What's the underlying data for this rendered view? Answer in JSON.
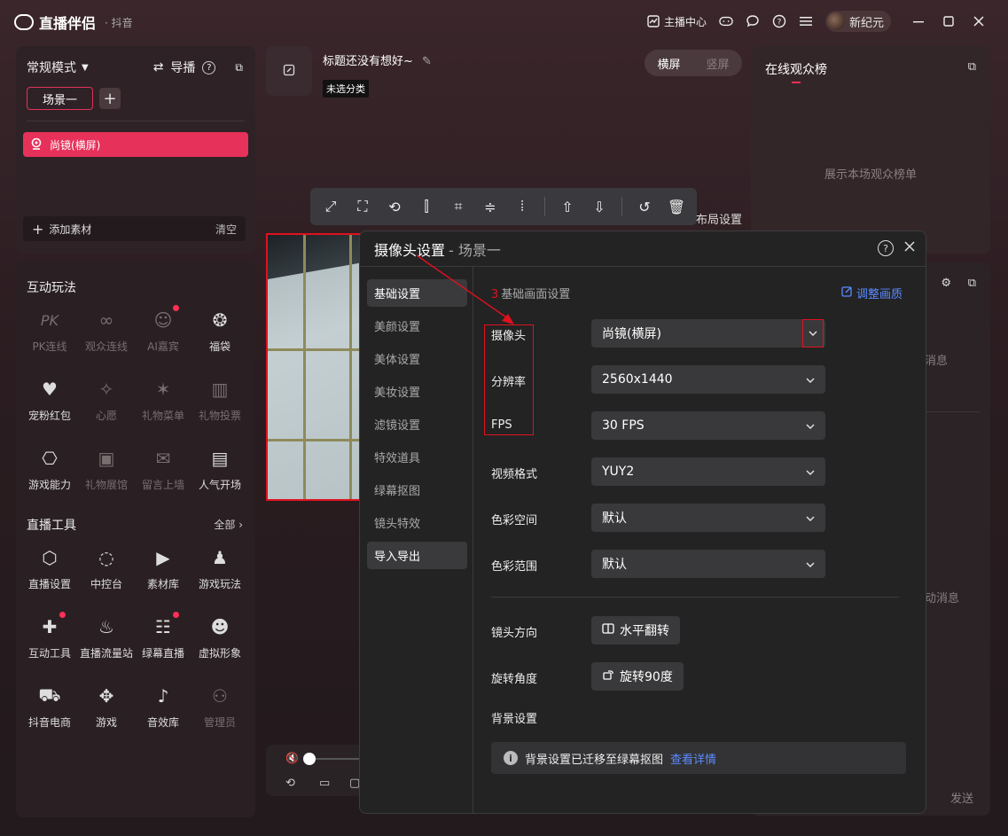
{
  "app": {
    "name": "直播伴侣",
    "platform": "· 抖音"
  },
  "titlebar": {
    "host_center": "主播中心",
    "username": "新纪元"
  },
  "scene_panel": {
    "mode": "常规模式",
    "guide": "导播",
    "scene_tab": "场景一",
    "source": "尚镜(横屏)",
    "add_source": "添加素材",
    "clear": "清空"
  },
  "interactive": {
    "title": "互动玩法",
    "items": [
      {
        "label": "PK连线",
        "icon": "pk-icon",
        "dim": true
      },
      {
        "label": "观众连线",
        "icon": "audience-link-icon",
        "dim": true
      },
      {
        "label": "AI嘉宾",
        "icon": "ai-guest-icon",
        "dim": true,
        "dot": true
      },
      {
        "label": "福袋",
        "icon": "lucky-bag-icon",
        "dim": false
      },
      {
        "label": "宠粉红包",
        "icon": "red-packet-icon",
        "dim": false
      },
      {
        "label": "心愿",
        "icon": "wish-icon",
        "dim": true
      },
      {
        "label": "礼物菜单",
        "icon": "gift-menu-icon",
        "dim": true
      },
      {
        "label": "礼物投票",
        "icon": "gift-vote-icon",
        "dim": true
      },
      {
        "label": "游戏能力",
        "icon": "game-ability-icon",
        "dim": false
      },
      {
        "label": "礼物展馆",
        "icon": "gift-hall-icon",
        "dim": true
      },
      {
        "label": "留言上墙",
        "icon": "message-wall-icon",
        "dim": true
      },
      {
        "label": "人气开场",
        "icon": "popularity-icon",
        "dim": false
      }
    ]
  },
  "live_tools": {
    "title": "直播工具",
    "all": "全部",
    "items": [
      {
        "label": "直播设置",
        "icon": "live-settings-icon",
        "dim": false
      },
      {
        "label": "中控台",
        "icon": "control-panel-icon",
        "dim": false
      },
      {
        "label": "素材库",
        "icon": "material-lib-icon",
        "dim": false
      },
      {
        "label": "游戏玩法",
        "icon": "game-play-icon",
        "dim": false
      },
      {
        "label": "互动工具",
        "icon": "interactive-tool-icon",
        "dim": false,
        "dot": true
      },
      {
        "label": "直播流量站",
        "icon": "traffic-station-icon",
        "dim": false
      },
      {
        "label": "绿幕直播",
        "icon": "green-screen-icon",
        "dim": false,
        "dot": true
      },
      {
        "label": "虚拟形象",
        "icon": "avatar-virtual-icon",
        "dim": false
      },
      {
        "label": "抖音电商",
        "icon": "ecommerce-icon",
        "dim": false
      },
      {
        "label": "游戏",
        "icon": "gamepad-icon",
        "dim": false
      },
      {
        "label": "音效库",
        "icon": "sound-lib-icon",
        "dim": false
      },
      {
        "label": "管理员",
        "icon": "admin-icon",
        "dim": true
      }
    ]
  },
  "stream": {
    "title": "标题还没有想好~",
    "category": "未选分类",
    "orient_h": "横屏",
    "orient_v": "竖屏",
    "layout_settings": "布局设置"
  },
  "rank": {
    "title": "在线观众榜",
    "empty": "展示本场观众榜单"
  },
  "chat": {
    "peek1": "消息",
    "peek2": "动消息",
    "send": "发送"
  },
  "modal": {
    "title": "摄像头设置",
    "subtitle": "- 场景一",
    "nav": [
      "基础设置",
      "美颜设置",
      "美体设置",
      "美妆设置",
      "滤镜设置",
      "特效道具",
      "绿幕抠图",
      "镜头特效",
      "导入导出"
    ],
    "section_num": "3",
    "section_title": "基础画面设置",
    "adjust": "调整画质",
    "rows": [
      {
        "label": "摄像头",
        "value": "尚镜(横屏)"
      },
      {
        "label": "分辨率",
        "value": "2560x1440"
      },
      {
        "label": "FPS",
        "value": "30 FPS"
      },
      {
        "label": "视频格式",
        "value": "YUY2"
      },
      {
        "label": "色彩空间",
        "value": "默认"
      },
      {
        "label": "色彩范围",
        "value": "默认"
      }
    ],
    "lens_dir_label": "镜头方向",
    "lens_dir_btn": "水平翻转",
    "rotate_label": "旋转角度",
    "rotate_btn": "旋转90度",
    "bg_label": "背景设置",
    "bg_info": "背景设置已迁移至绿幕抠图",
    "bg_link": "查看详情"
  },
  "colors": {
    "accent": "#e6315a",
    "annotation": "#e0111e",
    "link": "#5b8bff"
  }
}
